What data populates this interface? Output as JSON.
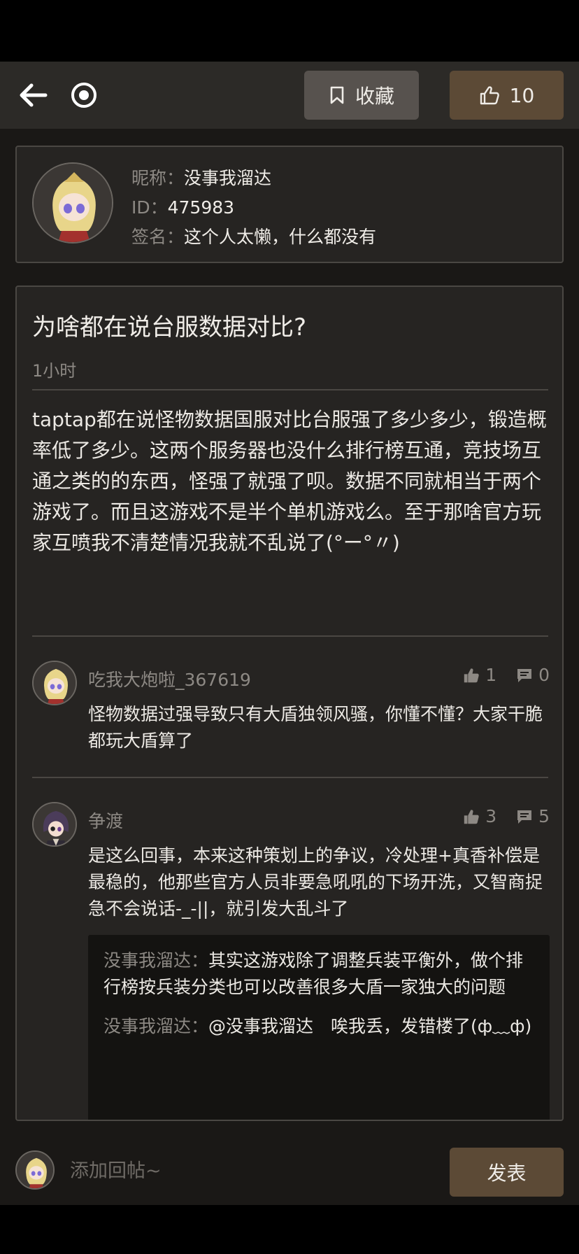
{
  "colors": {
    "accent": "#5c4a36",
    "panel": "#262422",
    "muted": "#8d8984"
  },
  "toolbar": {
    "back_icon": "arrow-left-icon",
    "target_icon": "target-icon",
    "favorite_label": "收藏",
    "favorite_icon": "bookmark-icon",
    "like_icon": "thumbs-up-icon",
    "like_count": "10"
  },
  "profile": {
    "nickname_label": "昵称：",
    "nickname": "没事我溜达",
    "id_label": "ID：",
    "id": "475983",
    "signature_label": "签名：",
    "signature": "这个人太懒，什么都没有"
  },
  "post": {
    "title": "为啥都在说台服数据对比?",
    "time": "1小时",
    "body": "taptap都在说怪物数据国服对比台服强了多少多少，锻造概率低了多少。这两个服务器也没什么排行榜互通，竞技场互通之类的的东西，怪强了就强了呗。数据不同就相当于两个游戏了。而且这游戏不是半个单机游戏么。至于那啥官方玩家互喷我不清楚情况我就不乱说了(°ー°〃)"
  },
  "comments": [
    {
      "name": "吃我大炮啦_367619",
      "likes": "1",
      "replies": "0",
      "text": "怪物数据过强导致只有大盾独领风骚，你懂不懂？大家干脆都玩大盾算了"
    },
    {
      "name": "争渡",
      "likes": "3",
      "replies": "5",
      "text": "是这么回事，本来这种策划上的争议，冷处理+真香补偿是最稳的，他那些官方人员非要急吼吼的下场开洗，又智商捉急不会说话-_-||，就引发大乱斗了",
      "sub_replies": [
        {
          "name": "没事我溜达：",
          "text": "其实这游戏除了调整兵装平衡外，做个排行榜按兵装分类也可以改善很多大盾一家独大的问题"
        },
        {
          "name": "没事我溜达：",
          "text": "@没事我溜达　唉我丢，发错楼了(ф﹏ф)"
        }
      ]
    }
  ],
  "reply_bar": {
    "placeholder": "添加回帖~",
    "send_label": "发表"
  }
}
